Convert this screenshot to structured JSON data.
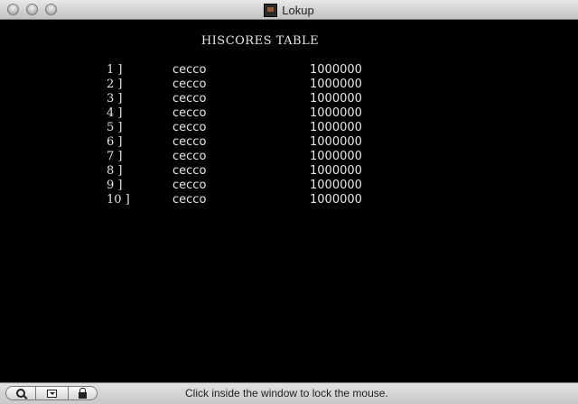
{
  "window": {
    "title": "Lokup"
  },
  "game": {
    "heading": "HISCORES TABLE",
    "scores": [
      {
        "rank": "1 ]",
        "name": "cecco",
        "score": "1000000"
      },
      {
        "rank": "2 ]",
        "name": "cecco",
        "score": "1000000"
      },
      {
        "rank": "3 ]",
        "name": "cecco",
        "score": "1000000"
      },
      {
        "rank": "4 ]",
        "name": "cecco",
        "score": "1000000"
      },
      {
        "rank": "5 ]",
        "name": "cecco",
        "score": "1000000"
      },
      {
        "rank": "6 ]",
        "name": "cecco",
        "score": "1000000"
      },
      {
        "rank": "7 ]",
        "name": "cecco",
        "score": "1000000"
      },
      {
        "rank": "8 ]",
        "name": "cecco",
        "score": "1000000"
      },
      {
        "rank": "9 ]",
        "name": "cecco",
        "score": "1000000"
      },
      {
        "rank": "10 ]",
        "name": "cecco",
        "score": "1000000"
      }
    ]
  },
  "statusbar": {
    "message": "Click inside the window to lock the mouse.",
    "icons": [
      "magnifier-icon",
      "drop-menu-icon",
      "lock-icon"
    ]
  }
}
